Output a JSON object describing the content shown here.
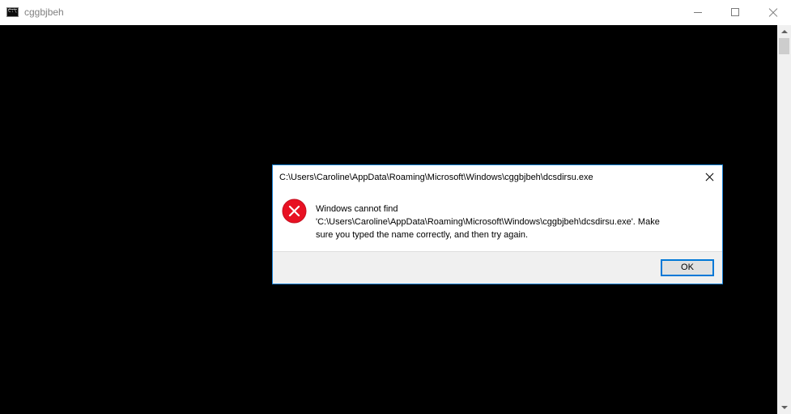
{
  "window": {
    "title": "cggbjbeh",
    "icon": "cmd-console-icon",
    "icon_text": "C:\\",
    "buttons": [
      "minimize",
      "maximize",
      "close"
    ]
  },
  "console": {
    "background": "#000000"
  },
  "dialog": {
    "title": "C:\\Users\\Caroline\\AppData\\Roaming\\Microsoft\\Windows\\cggbjbeh\\dcsdirsu.exe",
    "icon": "error-icon",
    "message_lines": [
      "Windows cannot find",
      "'C:\\Users\\Caroline\\AppData\\Roaming\\Microsoft\\Windows\\cggbjbeh\\dcsdirsu.exe'. Make",
      "sure you typed the name correctly, and then try again."
    ],
    "ok_label": "OK",
    "accent_color": "#0078d7",
    "error_color": "#e81123"
  }
}
